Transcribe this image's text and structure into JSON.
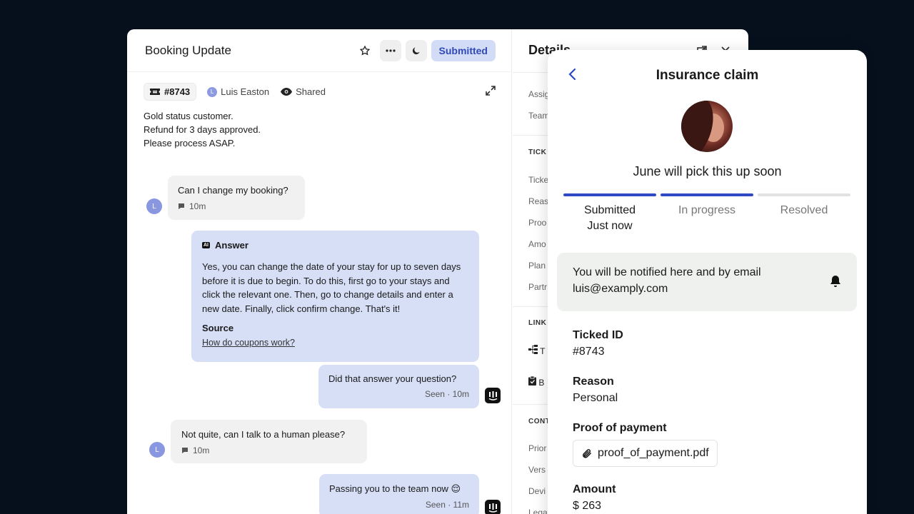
{
  "window": {
    "title": "Booking Update",
    "status": "Submitted",
    "ticket_id": "#8743",
    "assignee": "Luis Easton",
    "assignee_initial": "L",
    "visibility": "Shared",
    "note_lines": [
      "Gold status customer.",
      "Refund for 3 days approved.",
      "Please process ASAP."
    ]
  },
  "conversation": [
    {
      "from": "user",
      "text": "Can I change my booking?",
      "time": "10m"
    },
    {
      "from": "ai",
      "badge": "AI",
      "heading": "Answer",
      "text": "Yes, you can change the date of your stay for up to seven days before it is due to begin. To do this, first go to your stays and click the relevant one. Then, go to change details and enter a new date. Finally, click confirm change. That's it!",
      "source_label": "Source",
      "source_link": "How do coupons work?"
    },
    {
      "from": "bot",
      "text": "Did that answer your question?",
      "meta": "Seen · 10m"
    },
    {
      "from": "user",
      "text": "Not quite, can I talk to a human please?",
      "time": "10m"
    },
    {
      "from": "bot",
      "text": "Passing you to the team now 😌",
      "meta": "Seen · 11m"
    }
  ],
  "details": {
    "title": "Details",
    "lines": [
      "Assig",
      "Team",
      "Ticke",
      "Reas",
      "Proo",
      "Amo",
      "Plan",
      "Partr",
      "T",
      "B",
      "Prior",
      "Vers",
      "Devi",
      "Lega"
    ],
    "sections": [
      "TICK",
      "LINK",
      "CONT"
    ]
  },
  "overlay": {
    "title": "Insurance claim",
    "subtitle": "June will pick this up soon",
    "steps": [
      {
        "label": "Submitted",
        "sub": "Just now",
        "done": true
      },
      {
        "label": "In progress",
        "sub": "",
        "done": true
      },
      {
        "label": "Resolved",
        "sub": "",
        "done": false
      }
    ],
    "notify_text": "You will be notified here and by email",
    "notify_email": "luis@examply.com",
    "fields": [
      {
        "label": "Ticked ID",
        "value": "#8743"
      },
      {
        "label": "Reason",
        "value": "Personal"
      },
      {
        "label": "Proof of payment",
        "value": "proof_of_payment.pdf"
      },
      {
        "label": "Amount",
        "value": "$ 263"
      }
    ]
  },
  "colors": {
    "accent": "#2f49c4",
    "status_bg": "#d3dcf6",
    "bot_bubble": "#d6dff6",
    "user_bubble": "#f0f1f0",
    "background": "#06101c"
  }
}
